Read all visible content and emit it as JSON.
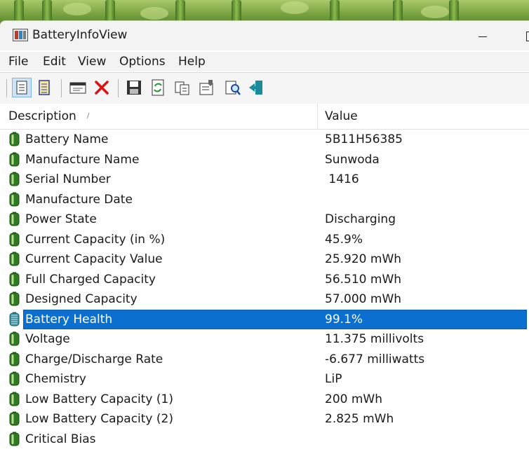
{
  "window": {
    "title": "BatteryInfoView"
  },
  "menu": [
    "File",
    "Edit",
    "View",
    "Options",
    "Help"
  ],
  "toolbar": {
    "icons": [
      "details-view-icon",
      "list-view-icon",
      "properties-window-icon",
      "delete-icon",
      "save-icon",
      "refresh-icon",
      "copy-icon",
      "properties-icon",
      "find-icon",
      "exit-icon"
    ]
  },
  "columns": {
    "description": "Description",
    "value": "Value"
  },
  "rows": [
    {
      "description": "Battery Name",
      "value": "5B11H56385"
    },
    {
      "description": "Manufacture Name",
      "value": "Sunwoda"
    },
    {
      "description": "Serial Number",
      "value": " 1416"
    },
    {
      "description": "Manufacture Date",
      "value": ""
    },
    {
      "description": "Power State",
      "value": "Discharging"
    },
    {
      "description": "Current Capacity (in %)",
      "value": "45.9%"
    },
    {
      "description": "Current Capacity Value",
      "value": "25.920 mWh"
    },
    {
      "description": "Full Charged Capacity",
      "value": "56.510 mWh"
    },
    {
      "description": "Designed Capacity",
      "value": "57.000 mWh"
    },
    {
      "description": "Battery Health",
      "value": "99.1%",
      "selected": true
    },
    {
      "description": "Voltage",
      "value": "11.375 millivolts"
    },
    {
      "description": "Charge/Discharge Rate",
      "value": "-6.677 milliwatts"
    },
    {
      "description": "Chemistry",
      "value": "LiP"
    },
    {
      "description": "Low Battery Capacity (1)",
      "value": "200 mWh"
    },
    {
      "description": "Low Battery Capacity (2)",
      "value": "2.825 mWh"
    },
    {
      "description": "Critical Bias",
      "value": ""
    }
  ],
  "colors": {
    "selection": "#0a6fcf",
    "battery": "#3d8a2a"
  }
}
